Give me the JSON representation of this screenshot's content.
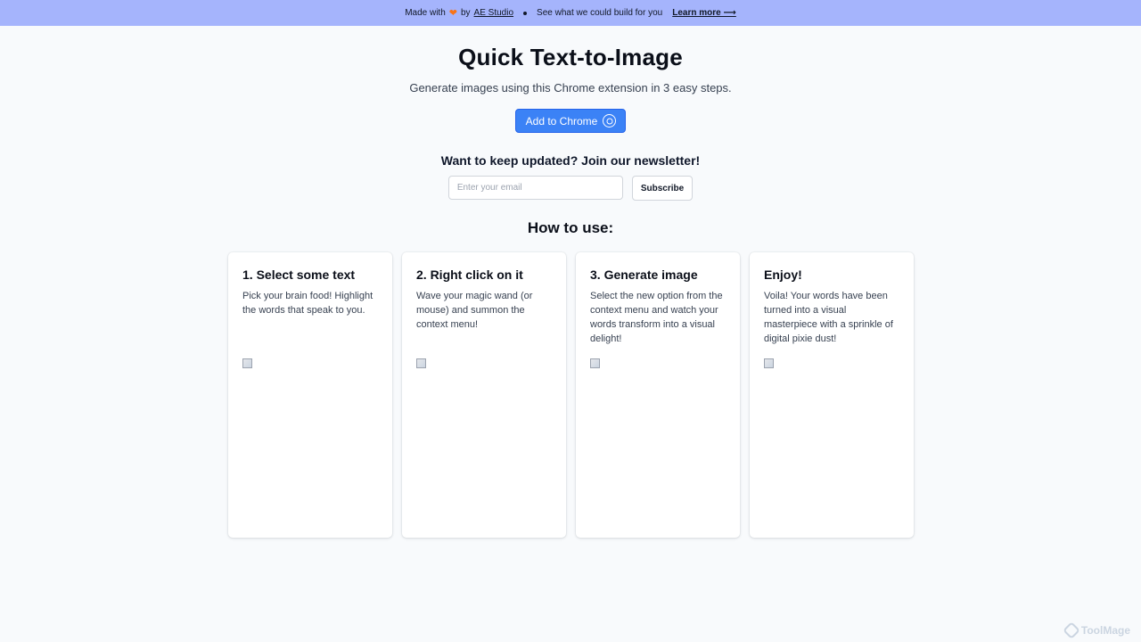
{
  "banner": {
    "made_with": "Made with",
    "heart_icon": "heart-icon",
    "by": "by",
    "studio_link": "AE Studio",
    "cta_text": "See what we could build for you",
    "learn_more": "Learn more ⟶"
  },
  "hero": {
    "title": "Quick Text-to-Image",
    "subtitle": "Generate images using this Chrome extension in 3 easy steps.",
    "add_button": "Add to Chrome"
  },
  "newsletter": {
    "title": "Want to keep updated? Join our newsletter!",
    "email_placeholder": "Enter your email",
    "subscribe_label": "Subscribe"
  },
  "how_to": {
    "title": "How to use:",
    "steps": [
      {
        "title": "1. Select some text",
        "text": "Pick your brain food! Highlight the words that speak to you."
      },
      {
        "title": "2. Right click on it",
        "text": "Wave your magic wand (or mouse) and summon the context menu!"
      },
      {
        "title": "3. Generate image",
        "text": "Select the new option from the context menu and watch your words transform into a visual delight!"
      },
      {
        "title": "Enjoy!",
        "text": "Voila! Your words have been turned into a visual masterpiece with a sprinkle of digital pixie dust!"
      }
    ]
  },
  "watermark": {
    "text": "ToolMage"
  },
  "colors": {
    "banner": "#a5b4fc",
    "accent": "#3b82f6",
    "background": "#f8fafc"
  }
}
